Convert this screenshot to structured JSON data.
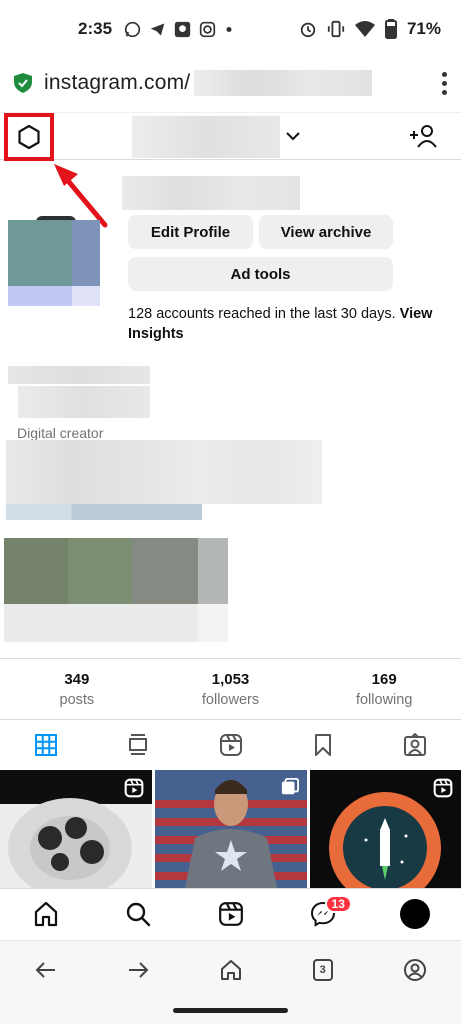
{
  "status_bar": {
    "time": "2:35",
    "app_icons": [
      "whatsapp-icon",
      "telegram-icon",
      "app-icon",
      "instagram-icon",
      "dot-icon"
    ],
    "status_icons": [
      "alarm-icon",
      "vibrate-icon",
      "wifi-icon",
      "battery-icon"
    ],
    "battery": "71%"
  },
  "browser": {
    "url_text": "instagram.com/",
    "url_redacted": true,
    "menu_icon": "more-vert-icon",
    "nav_icons": [
      "back-icon",
      "forward-icon",
      "home-icon",
      "tabs-icon",
      "account-icon"
    ],
    "tab_count": "3"
  },
  "header": {
    "settings_icon": "settings-icon",
    "username_redacted": true,
    "dropdown_icon": "chevron-down-icon",
    "add_user_icon": "add-user-icon",
    "highlight_color": "#e3131b"
  },
  "profile": {
    "edit_profile_label": "Edit Profile",
    "view_archive_label": "View archive",
    "ad_tools_label": "Ad tools",
    "reach_text": "128 accounts reached in the last 30 days.",
    "reach_link": "View Insights",
    "category": "Digital creator"
  },
  "stats": {
    "posts": {
      "value": "349",
      "label": "posts"
    },
    "followers": {
      "value": "1,053",
      "label": "followers"
    },
    "following": {
      "value": "169",
      "label": "following"
    }
  },
  "tabs": {
    "items": [
      "grid-icon",
      "feed-icon",
      "reels-icon",
      "saved-icon",
      "tagged-icon"
    ],
    "active_index": 0,
    "active_color": "#0095f6"
  },
  "grid": {
    "tiles": [
      {
        "type": "reel",
        "badge_icon": "reels-icon"
      },
      {
        "type": "carousel",
        "badge_icon": "carousel-icon"
      },
      {
        "type": "reel",
        "badge_icon": "reels-icon"
      }
    ]
  },
  "bottom_nav": {
    "items": [
      "home-icon",
      "search-icon",
      "reels-icon",
      "messenger-icon",
      "profile-avatar"
    ],
    "messages_badge": "13"
  }
}
